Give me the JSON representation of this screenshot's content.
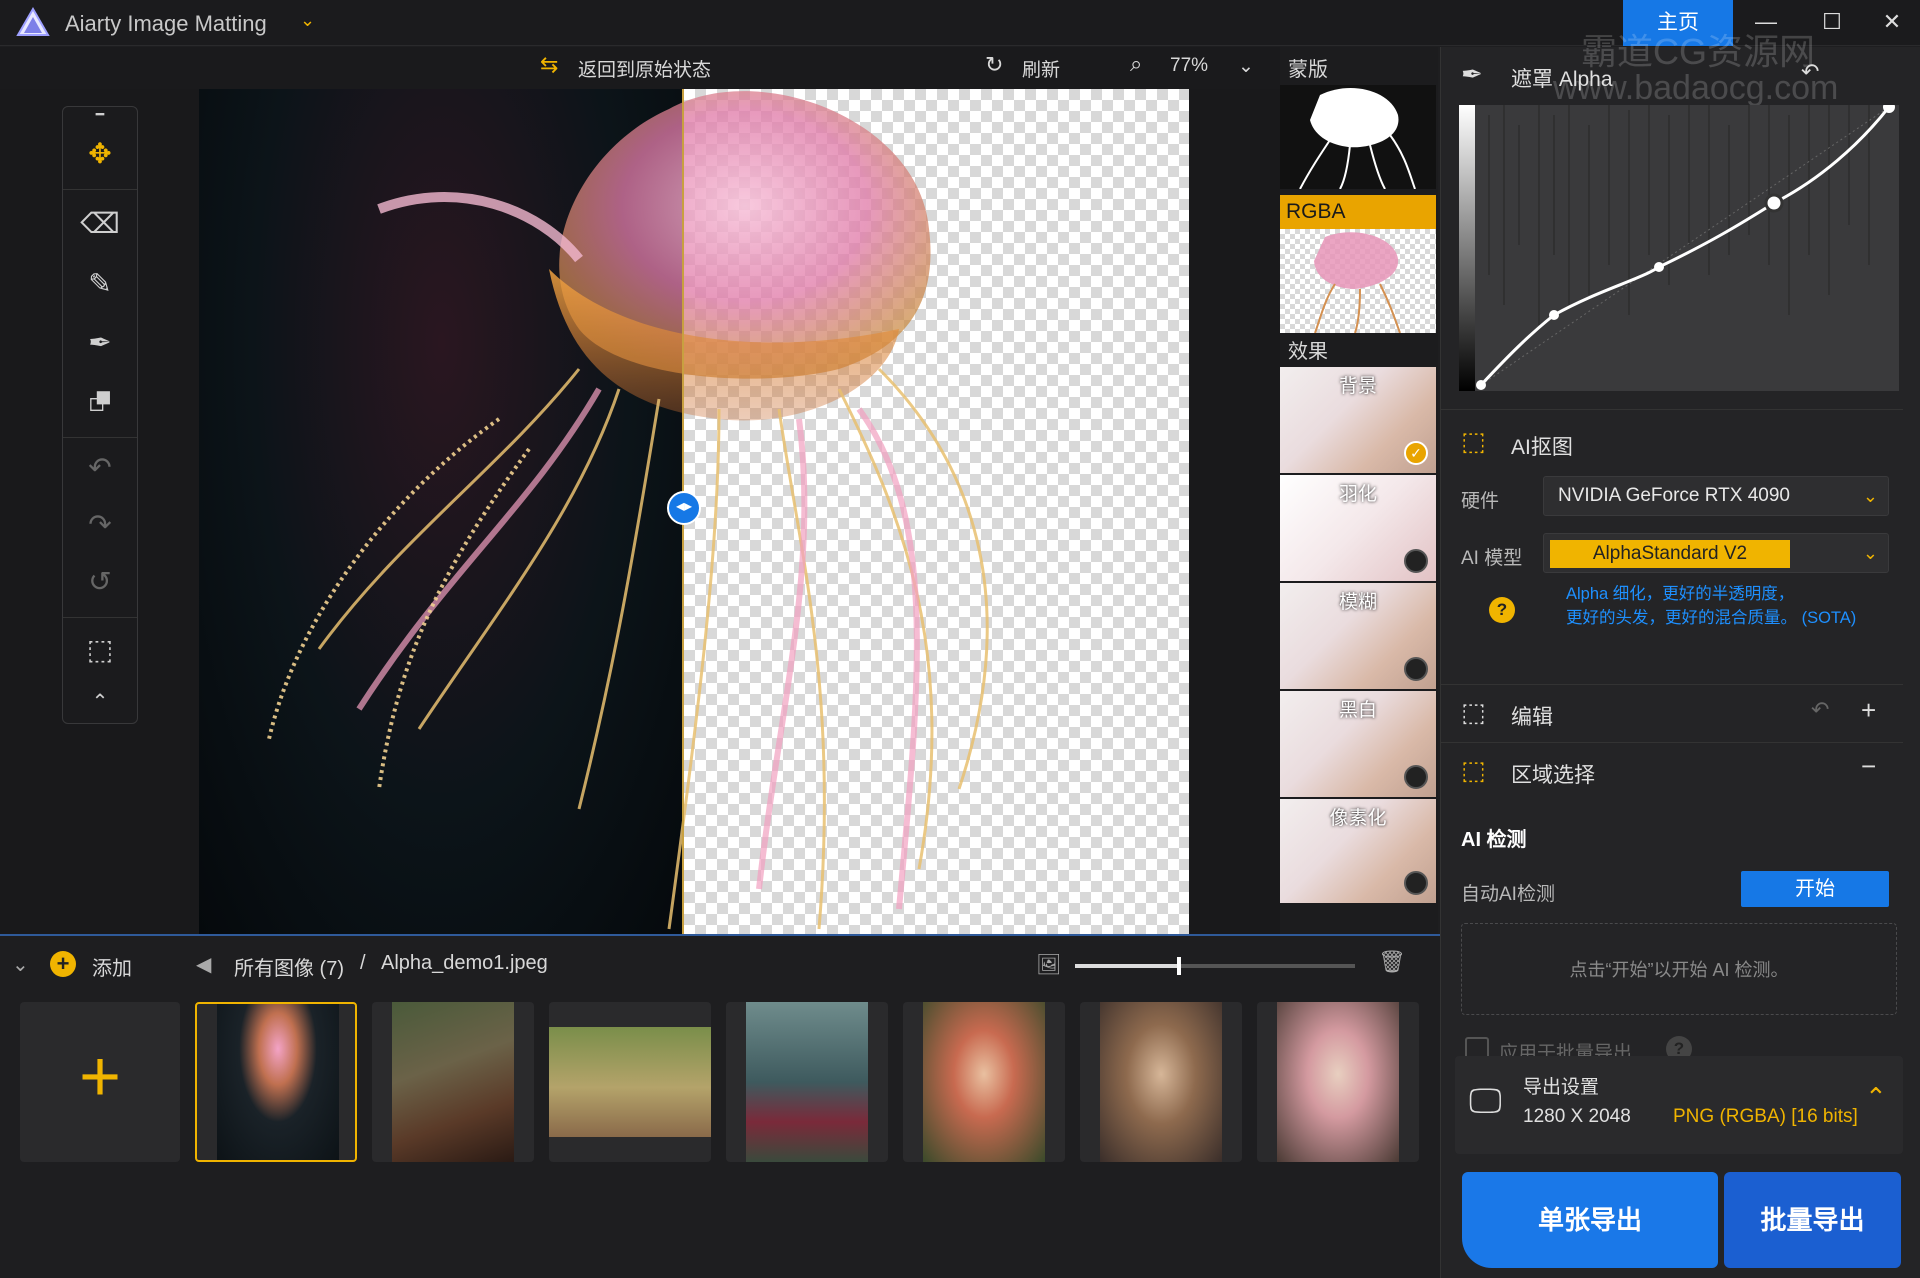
{
  "window": {
    "title": "Aiarty Image Matting",
    "home_tab": "主页",
    "minimize": "—",
    "maximize": "☐",
    "close": "✕"
  },
  "watermark": {
    "line1": "霸道CG资源网",
    "line2": "www.badaocg.com"
  },
  "top_toolbar": {
    "revert_label": "返回到原始状态",
    "refresh_label": "刷新",
    "zoom": "77%"
  },
  "side_column": {
    "mask_label": "蒙版",
    "rgba_label": "RGBA",
    "effects_label": "效果",
    "effects": [
      {
        "label": "背景",
        "selected": true
      },
      {
        "label": "羽化",
        "selected": false
      },
      {
        "label": "模糊",
        "selected": false
      },
      {
        "label": "黑白",
        "selected": false
      },
      {
        "label": "像素化",
        "selected": false
      }
    ]
  },
  "right_panel": {
    "alpha_title": "遮罩 Alpha",
    "ai_matting": {
      "title": "AI抠图",
      "hardware_label": "硬件",
      "hardware_value": "NVIDIA GeForce RTX 4090",
      "model_label": "AI 模型",
      "model_value": "AlphaStandard  V2",
      "info_line1": "Alpha 细化，更好的半透明度，",
      "info_line2": "更好的头发，更好的混合质量。",
      "info_tag": "(SOTA)",
      "help": "?"
    },
    "edit": {
      "title": "编辑"
    },
    "region": {
      "title": "区域选择",
      "ai_detect_title": "AI 检测",
      "auto_label": "自动AI检测",
      "start_button": "开始",
      "hint": "点击“开始”以开始 AI 检测。",
      "apply_batch_label": "应用于批量导出",
      "help": "?"
    },
    "export": {
      "title": "导出设置",
      "resolution": "1280 X 2048",
      "format": "PNG (RGBA) [16 bits]",
      "single_button": "单张导出",
      "batch_button": "批量导出"
    }
  },
  "bottom_bar": {
    "add_label": "添加",
    "add_icon": "+",
    "all_images": "所有图像 (7)",
    "separator": "/",
    "current_file": "Alpha_demo1.jpeg",
    "thumb_size": 0.37
  },
  "gallery": {
    "add_icon": "+",
    "items": [
      {
        "name": "jellyfish",
        "selected": true
      },
      {
        "name": "axe-forest",
        "selected": false
      },
      {
        "name": "bicycle",
        "selected": false
      },
      {
        "name": "woman-red-dress",
        "selected": false
      },
      {
        "name": "girl-flowers",
        "selected": false
      },
      {
        "name": "woman-roses",
        "selected": false
      },
      {
        "name": "girl-pink-flowers",
        "selected": false
      }
    ]
  },
  "colors": {
    "accent": "#f0b400",
    "primary": "#1678e6"
  }
}
